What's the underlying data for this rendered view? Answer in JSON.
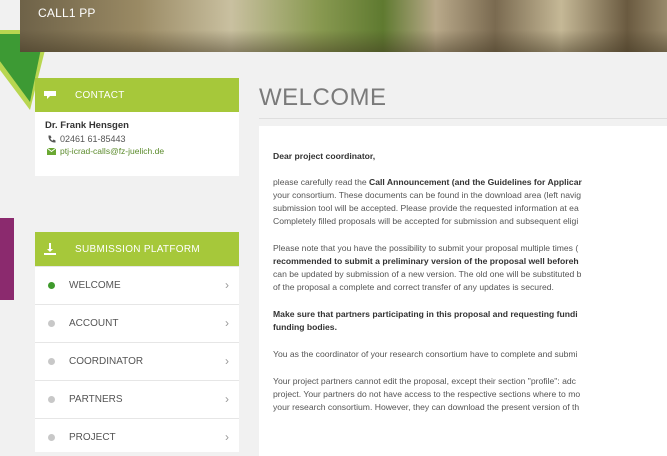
{
  "banner": {
    "title": "CALL1 PP"
  },
  "contact": {
    "header": "CONTACT",
    "name": "Dr. Frank Hensgen",
    "phone": "02461 61-85443",
    "email": "ptj-icrad-calls@fz-juelich.de"
  },
  "submission": {
    "header": "SUBMISSION PLATFORM",
    "items": [
      {
        "label": "WELCOME",
        "active": true
      },
      {
        "label": "ACCOUNT"
      },
      {
        "label": "COORDINATOR"
      },
      {
        "label": "PARTNERS"
      },
      {
        "label": "PROJECT"
      }
    ]
  },
  "main": {
    "title": "WELCOME",
    "greeting": "Dear project coordinator,",
    "p1": {
      "l1a": "please carefully read the ",
      "l1b": "Call Announcement (and the Guidelines for Applicar",
      "l2": "your consortium. These documents can be found in the download area (left navig",
      "l3": "submission tool will be accepted. Please provide the requested information at ea",
      "l4": "Completely filled proposals will be accepted for submission and subsequent eligi"
    },
    "p2": {
      "l1": "Please note that you have the possibility to submit your proposal multiple times (",
      "l2": "recommended to submit a preliminary version of the proposal well beforeh",
      "l3": "can be updated by submission of a new version. The old one will be substituted b",
      "l4": "of the proposal a complete and correct transfer of any updates is secured."
    },
    "p3": {
      "l1": "Make sure that partners participating in this proposal and requesting fundi",
      "l2": "funding bodies."
    },
    "p4": "You as the coordinator of your research consortium have to complete and submi",
    "p5": {
      "l1": "Your project partners cannot edit the proposal, except their section \"profile\": adc",
      "l2": "project. Your partners do not have access to the respective sections where to mo",
      "l3": "your research consortium. However, they can download the present version of th"
    }
  },
  "colors": {
    "accent": "#a6c83a",
    "active_dot": "#3f9a2c"
  }
}
